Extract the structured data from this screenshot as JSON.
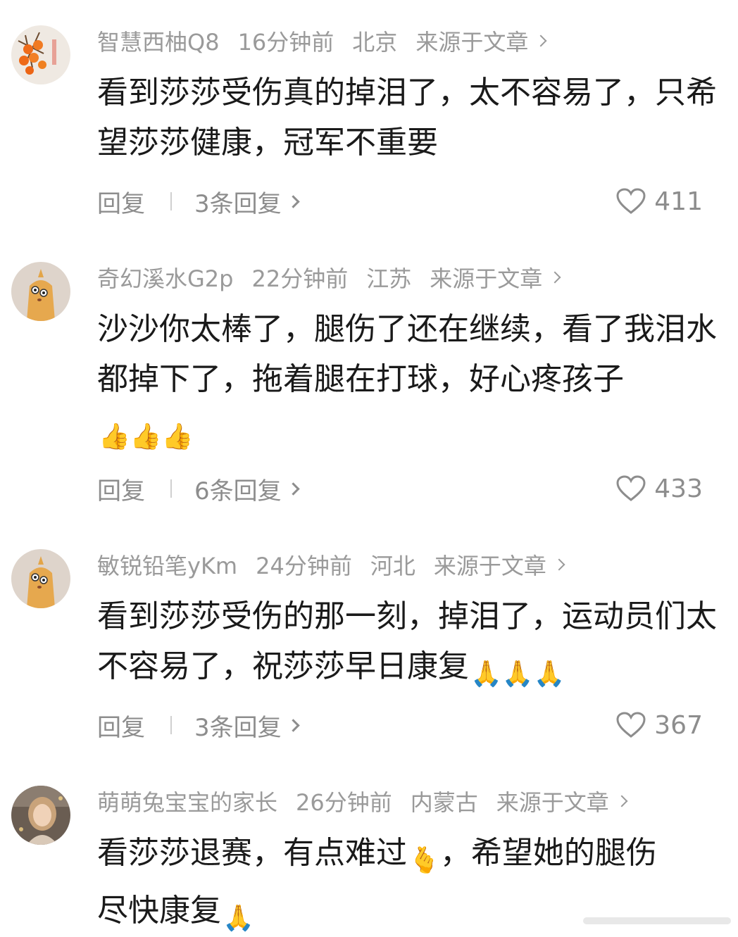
{
  "comments": [
    {
      "username": "智慧西柚Q8",
      "time": "16分钟前",
      "location": "北京",
      "source": "来源于文章",
      "text": "看到莎莎受伤真的掉泪了，太不容易了，只希望莎莎健康，冠军不重要",
      "emojis": "",
      "reply_label": "回复",
      "replies_label": "3条回复",
      "likes": "411",
      "avatar": "persimmon-avatar"
    },
    {
      "username": "奇幻溪水G2p",
      "time": "22分钟前",
      "location": "江苏",
      "source": "来源于文章",
      "text": "沙沙你太棒了，腿伤了还在继续，看了我泪水都掉下了，拖着腿在打球，好心疼孩子",
      "emojis": "👍👍👍",
      "reply_label": "回复",
      "replies_label": "6条回复",
      "likes": "433",
      "avatar": "cartoon-avatar"
    },
    {
      "username": "敏锐铅笔yKm",
      "time": "24分钟前",
      "location": "河北",
      "source": "来源于文章",
      "text": "看到莎莎受伤的那一刻，掉泪了，运动员们太不容易了，祝莎莎早日康复",
      "emojis": "🙏🙏🙏",
      "reply_label": "回复",
      "replies_label": "3条回复",
      "likes": "367",
      "avatar": "cartoon-avatar"
    },
    {
      "username": "萌萌兔宝宝的家长",
      "time": "26分钟前",
      "location": "内蒙古",
      "source": "来源于文章",
      "text_part1": "看莎莎退赛，有点难过",
      "emoji_mid": "🫰",
      "text_part2": "，希望她的腿伤尽快康复",
      "emojis": "🙏",
      "avatar": "photo-avatar"
    }
  ],
  "colors": {
    "text": "#1a1a1a",
    "meta": "#9a9a9a",
    "action": "#8d8d8d"
  }
}
